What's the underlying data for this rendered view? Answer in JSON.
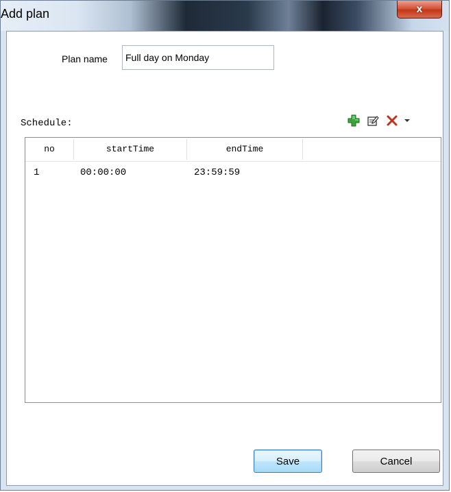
{
  "window": {
    "title": "Add plan",
    "close_glyph": "x"
  },
  "form": {
    "plan_name_label": "Plan name",
    "plan_name_value": "Full day on Monday"
  },
  "schedule": {
    "label": "Schedule:",
    "toolbar": {
      "add_icon": "add-icon",
      "edit_icon": "edit-icon",
      "delete_icon": "delete-icon",
      "dropdown_icon": "chevron-down-icon",
      "add_color": "#3aa33a",
      "delete_color": "#c0301d"
    },
    "columns": [
      "no",
      "startTime",
      "endTime",
      ""
    ],
    "rows": [
      {
        "no": "1",
        "startTime": "00:00:00",
        "endTime": "23:59:59"
      }
    ]
  },
  "buttons": {
    "save": "Save",
    "cancel": "Cancel"
  }
}
